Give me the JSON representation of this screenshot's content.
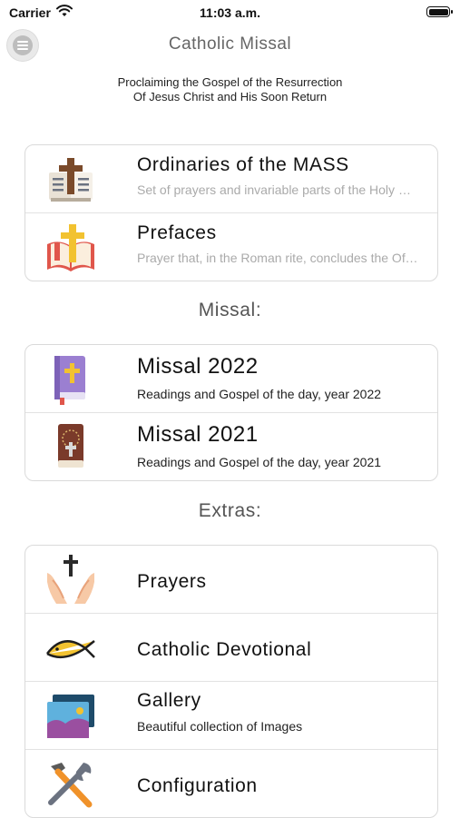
{
  "status_bar": {
    "carrier": "Carrier",
    "time": "11:03 a.m."
  },
  "header": {
    "title": "Catholic Missal",
    "menu_icon": "hamburger-menu-icon",
    "subtitle_line1": "Proclaiming the Gospel of the Resurrection",
    "subtitle_line2": "Of Jesus Christ and His Soon Return"
  },
  "main_card": [
    {
      "title": "Ordinaries of the MASS",
      "description": "Set of prayers and invariable parts of the Holy Mass",
      "icon": "book-cross-icon"
    },
    {
      "title": "Prefaces",
      "description": "Prayer that, in the Roman rite, concludes the Offertory",
      "icon": "open-bible-cross-icon"
    }
  ],
  "missal_section": {
    "label": "Missal:",
    "items": [
      {
        "title": "Missal 2022",
        "description": "Readings and Gospel of the day, year 2022",
        "icon": "purple-bible-icon"
      },
      {
        "title": "Missal 2021",
        "description": "Readings and Gospel of the day, year 2021",
        "icon": "rosary-bible-icon"
      }
    ]
  },
  "extras_section": {
    "label": "Extras:",
    "items": [
      {
        "title": "Prayers",
        "icon": "praying-hands-icon"
      },
      {
        "title": "Catholic Devotional",
        "icon": "ichthys-fish-icon"
      },
      {
        "title": "Gallery",
        "description": "Beautiful collection of Images",
        "icon": "gallery-images-icon"
      },
      {
        "title": "Configuration",
        "icon": "tools-icon"
      }
    ]
  },
  "colors": {
    "accent_gold": "#f2c230",
    "card_border": "#dadada",
    "muted_text": "#aaaaaa"
  }
}
